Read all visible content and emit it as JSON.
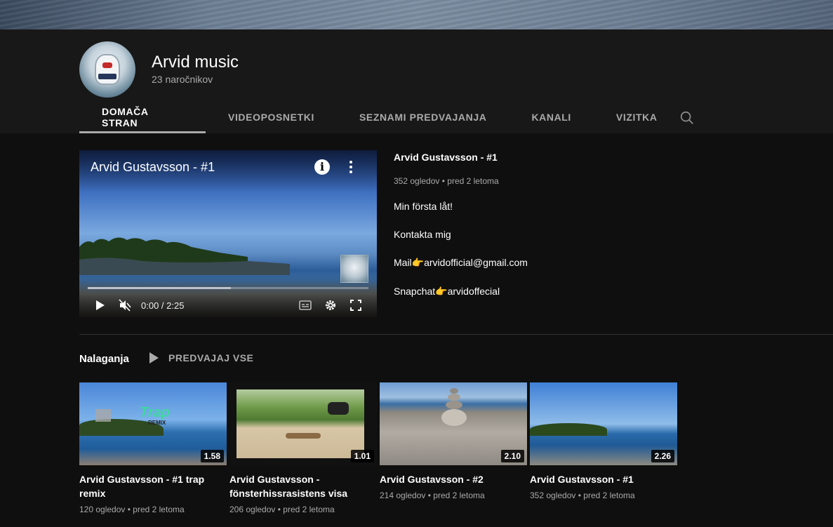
{
  "channel": {
    "name": "Arvid music",
    "subscribers": "23 naročnikov"
  },
  "tabs": [
    {
      "label": "DOMAČA STRAN",
      "active": true
    },
    {
      "label": "VIDEOPOSNETKI",
      "active": false
    },
    {
      "label": "SEZNAMI PREDVAJANJA",
      "active": false
    },
    {
      "label": "KANALI",
      "active": false
    },
    {
      "label": "VIZITKA",
      "active": false
    }
  ],
  "icons": {
    "search": "search-icon",
    "info": "info-icon",
    "more": "more-vert-icon",
    "play": "play-icon",
    "mute": "volume-muted-icon",
    "captions": "captions-icon",
    "settings": "gear-icon",
    "fullscreen": "fullscreen-icon"
  },
  "featured": {
    "player_title": "Arvid Gustavsson - #1",
    "info_glyph": "i",
    "time": "0:00 / 2:25",
    "progress_loaded": 0.51,
    "title": "Arvid Gustavsson - #1",
    "views": "352 ogledov",
    "age": "pred 2 letoma",
    "description": [
      "Min första låt!",
      "Kontakta mig",
      "Mail",
      "arvidofficial@gmail.com",
      "Snapchat",
      "arvidoffecial"
    ],
    "pointer_emoji": "👉"
  },
  "shelf": {
    "title": "Nalaganja",
    "play_all": "PREDVAJAJ VSE",
    "videos": [
      {
        "title": "Arvid Gustavsson - #1 trap remix",
        "views": "120 ogledov",
        "age": "pred 2 letoma",
        "duration": "1.58",
        "thumb_text": "Trap",
        "thumb_subtext": "REMIX"
      },
      {
        "title": "Arvid Gustavsson - fönsterhissrasistens visa",
        "views": "206 ogledov",
        "age": "pred 2 letoma",
        "duration": "1.01"
      },
      {
        "title": "Arvid Gustavsson - #2",
        "views": "214 ogledov",
        "age": "pred 2 letoma",
        "duration": "2.10"
      },
      {
        "title": "Arvid Gustavsson - #1",
        "views": "352 ogledov",
        "age": "pred 2 letoma",
        "duration": "2.26"
      }
    ]
  },
  "separator": "•",
  "colors": {
    "background": "#0f0f0f",
    "header": "#181818",
    "secondary_text": "#aaaaaa",
    "active_tab_underline": "#aaaaaa"
  }
}
